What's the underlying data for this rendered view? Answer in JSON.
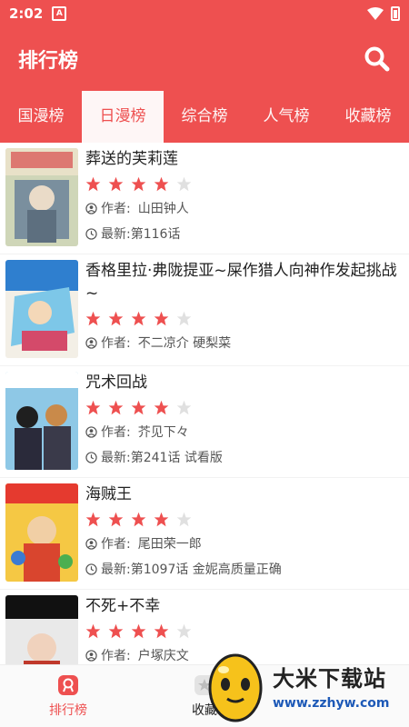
{
  "status_bar": {
    "time": "2:02",
    "sim_label": "A"
  },
  "app_bar": {
    "title": "排行榜"
  },
  "tabs": [
    {
      "label": "国漫榜"
    },
    {
      "label": "日漫榜"
    },
    {
      "label": "综合榜"
    },
    {
      "label": "人气榜"
    },
    {
      "label": "收藏榜"
    }
  ],
  "active_tab": 1,
  "comics": [
    {
      "title": "葬送的芙莉莲",
      "rating": 4,
      "author_label": "作者:",
      "author": "山田钟人",
      "latest_label": "最新:",
      "latest": "第116话"
    },
    {
      "title": "香格里拉·弗陇提亚~屎作猎人向神作发起挑战~",
      "rating": 4,
      "author_label": "作者:",
      "author": "不二凉介 硬梨菜",
      "latest_label": "",
      "latest": ""
    },
    {
      "title": "咒术回战",
      "rating": 4,
      "author_label": "作者:",
      "author": "芥见下々",
      "latest_label": "最新:",
      "latest": "第241话 试看版"
    },
    {
      "title": "海贼王",
      "rating": 4,
      "author_label": "作者:",
      "author": "尾田荣一郎",
      "latest_label": "最新:",
      "latest": "第1097话 金妮高质量正确"
    },
    {
      "title": "不死+不幸",
      "rating": 4,
      "author_label": "作者:",
      "author": "户塚庆文",
      "latest_label": "",
      "latest": ""
    }
  ],
  "bottom_nav": [
    {
      "label": "排行榜"
    },
    {
      "label": "收藏"
    }
  ],
  "watermark": {
    "title": "大米下载站",
    "url": "www.zzhyw.com"
  },
  "colors": {
    "primary": "#ee5050",
    "star_on": "#ee5050",
    "star_off": "#e0e0e0"
  }
}
